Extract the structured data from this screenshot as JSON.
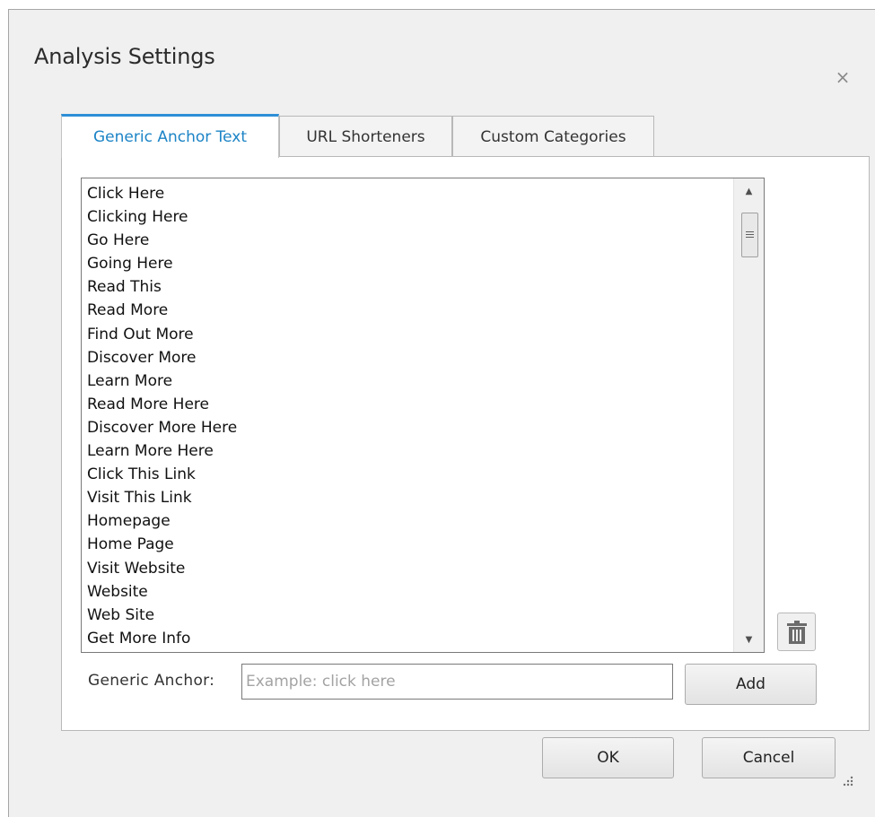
{
  "dialog": {
    "title": "Analysis Settings",
    "close_glyph": "×"
  },
  "tabs": [
    {
      "label": "Generic Anchor Text",
      "active": true
    },
    {
      "label": "URL Shorteners",
      "active": false
    },
    {
      "label": "Custom Categories",
      "active": false
    }
  ],
  "list": {
    "items": [
      "Click Here",
      "Clicking Here",
      "Go Here",
      "Going Here",
      "Read This",
      "Read More",
      "Find Out More",
      "Discover More",
      "Learn More",
      "Read More Here",
      "Discover More Here",
      "Learn More Here",
      "Click This Link",
      "Visit This Link",
      "Homepage",
      "Home Page",
      "Visit Website",
      "Website",
      "Web Site",
      "Get More Info"
    ]
  },
  "form": {
    "label": "Generic Anchor:",
    "placeholder": "Example: click here",
    "value": "",
    "add_label": "Add"
  },
  "footer": {
    "ok_label": "OK",
    "cancel_label": "Cancel"
  },
  "icons": {
    "delete": "trash-icon",
    "close": "close-icon",
    "scroll_up": "arrow-up-icon",
    "scroll_down": "arrow-down-icon",
    "resize": "resize-grip-icon"
  },
  "colors": {
    "accent": "#2e8fd6",
    "active_tab_text": "#1c84c6",
    "dialog_bg": "#f0f0f0"
  }
}
